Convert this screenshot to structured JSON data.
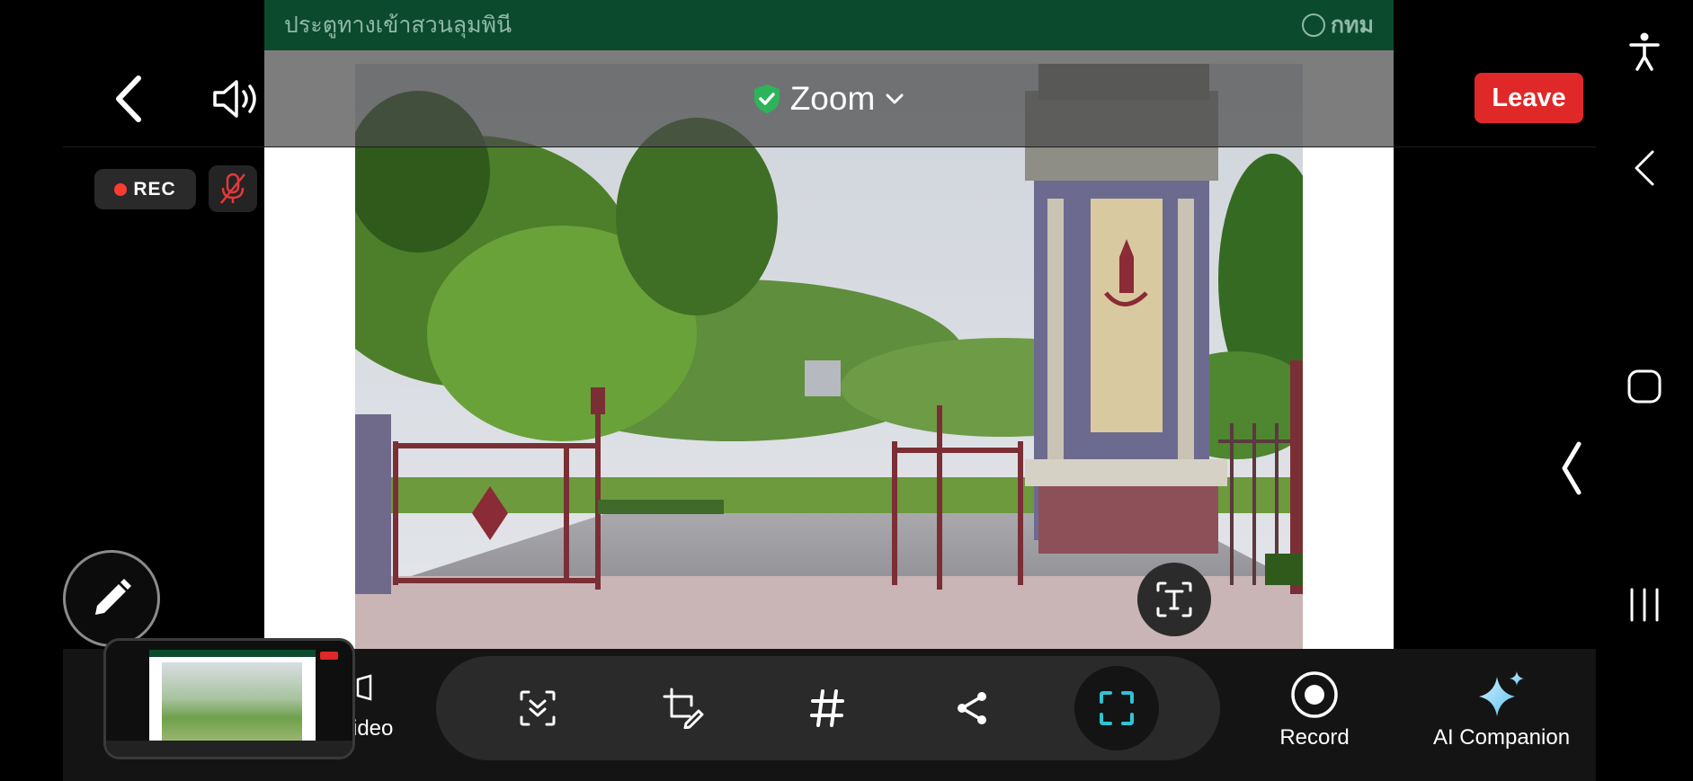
{
  "meeting": {
    "title": "Zoom",
    "leave_label": "Leave",
    "rec_label": "REC"
  },
  "shared_content": {
    "header_title": "ประตูทางเข้าสวนลุมพินี",
    "header_brand": "กทม"
  },
  "toolbar": {
    "video_label_fragment": "ideo",
    "record_label": "Record",
    "ai_companion_label": "AI Companion"
  },
  "colors": {
    "leave_red": "#e02828",
    "rec_dot": "#ff3b30",
    "shield_green": "#2fb35a",
    "share_header_green": "#0c4a2e",
    "active_capture_cyan": "#2ec4d6"
  },
  "icons": {
    "back": "chevron-left-icon",
    "speaker": "speaker-icon",
    "shield": "shield-check-icon",
    "dropdown": "chevron-down-icon",
    "muted_mic": "mic-off-icon",
    "pencil": "pencil-icon",
    "text_extract": "text-extract-icon",
    "scroll_capture": "scroll-capture-icon",
    "crop_edit": "crop-edit-icon",
    "tag": "hashtag-icon",
    "share": "share-icon",
    "capture": "capture-frame-icon",
    "record": "record-icon",
    "ai": "sparkle-icon",
    "accessibility": "accessibility-icon",
    "nav_back": "nav-back-icon",
    "nav_home": "nav-home-icon",
    "nav_recents": "nav-recents-icon",
    "edge_panel": "edge-panel-handle-icon"
  }
}
